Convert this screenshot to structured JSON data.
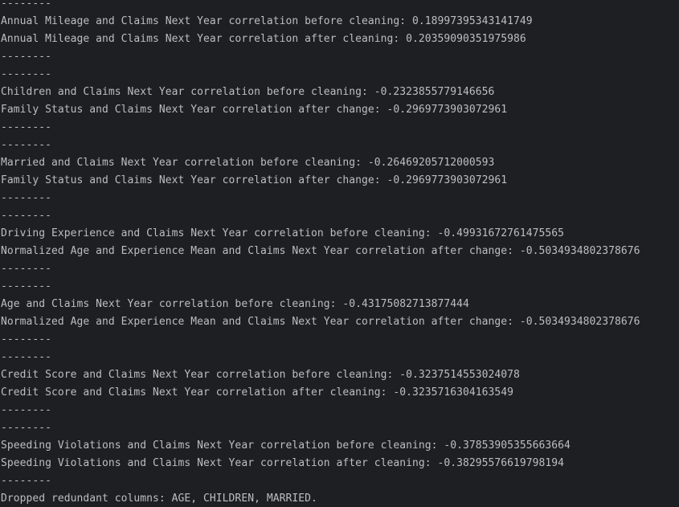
{
  "console": {
    "lines": [
      "--------",
      "Annual Mileage and Claims Next Year correlation before cleaning: 0.18997395343141749",
      "Annual Mileage and Claims Next Year correlation after cleaning: 0.20359090351975986",
      "--------",
      "--------",
      "Children and Claims Next Year correlation before cleaning: -0.2323855779146656",
      "Family Status and Claims Next Year correlation after change: -0.2969773903072961",
      "--------",
      "--------",
      "Married and Claims Next Year correlation before cleaning: -0.26469205712000593",
      "Family Status and Claims Next Year correlation after change: -0.2969773903072961",
      "--------",
      "--------",
      "Driving Experience and Claims Next Year correlation before cleaning: -0.49931672761475565",
      "Normalized Age and Experience Mean and Claims Next Year correlation after change: -0.5034934802378676",
      "--------",
      "--------",
      "Age and Claims Next Year correlation before cleaning: -0.43175082713877444",
      "Normalized Age and Experience Mean and Claims Next Year correlation after change: -0.5034934802378676",
      "--------",
      "--------",
      "Credit Score and Claims Next Year correlation before cleaning: -0.3237514553024078",
      "Credit Score and Claims Next Year correlation after cleaning: -0.3235716304163549",
      "--------",
      "--------",
      "Speeding Violations and Claims Next Year correlation before cleaning: -0.37853905355663664",
      "Speeding Violations and Claims Next Year correlation after cleaning: -0.38295576619798194",
      "--------",
      "Dropped redundant columns: AGE, CHILDREN, MARRIED."
    ]
  },
  "colors": {
    "background": "#1e1f22",
    "text": "#bcbec4"
  }
}
